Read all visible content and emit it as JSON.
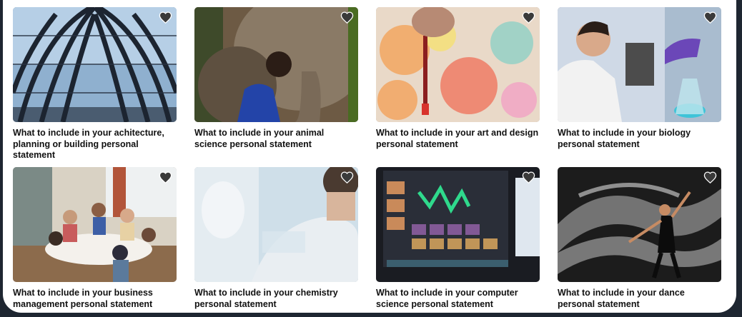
{
  "cards": [
    {
      "title": "What to include in your achitecture, planning or building personal statement",
      "image": "glass-dome-architecture-photo"
    },
    {
      "title": "What to include in your animal science personal statement",
      "image": "elephant-and-person-photo"
    },
    {
      "title": "What to include in your art and design personal statement",
      "image": "paintbrush-canvas-photo"
    },
    {
      "title": "What to include in your biology personal statement",
      "image": "lab-scientist-microscope-photo"
    },
    {
      "title": "What to include in your business management personal statement",
      "image": "team-meeting-table-photo"
    },
    {
      "title": "What to include in your chemistry personal statement",
      "image": "blurred-lab-coat-photo"
    },
    {
      "title": "What to include in your computer science personal statement",
      "image": "monitor-waveform-photo"
    },
    {
      "title": "What to include in your dance personal statement",
      "image": "dancer-flowing-fabric-photo"
    }
  ],
  "icons": {
    "favourite": "heart-icon"
  },
  "colors": {
    "page_background": "#1e2631",
    "panel": "#ffffff",
    "title_text": "#111111"
  }
}
